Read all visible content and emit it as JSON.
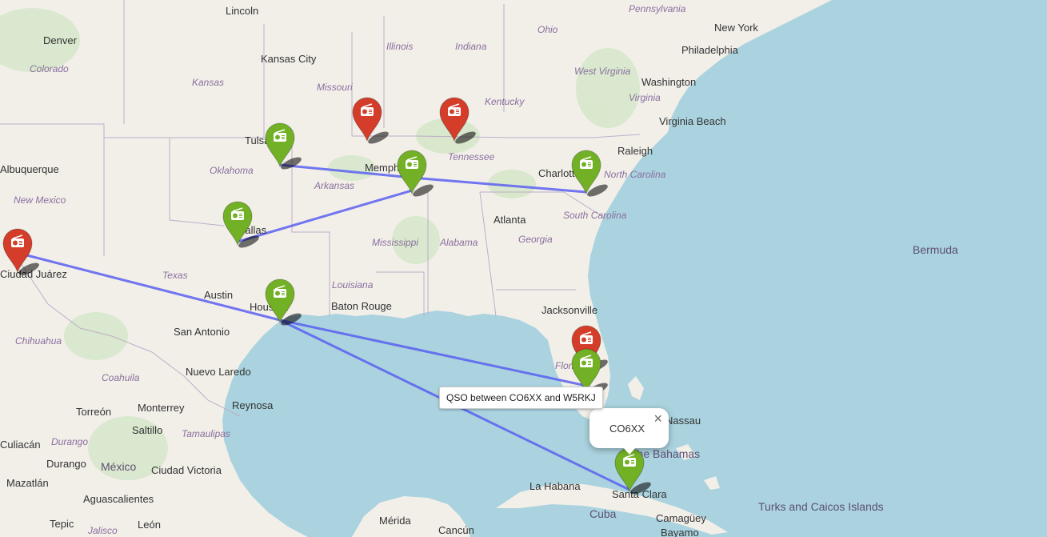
{
  "map": {
    "labels": {
      "cities": [
        "Lincoln",
        "Denver",
        "Kansas City",
        "Tulsa",
        "Memphis",
        "Charlotte",
        "Raleigh",
        "Virginia Beach",
        "Washington",
        "Philadelphia",
        "New York",
        "Atlanta",
        "Jacksonville",
        "Austin",
        "Houston",
        "San Antonio",
        "Baton Rouge",
        "Nuevo Laredo",
        "Reynosa",
        "Monterrey",
        "Torreón",
        "Saltillo",
        "Durango",
        "Ciudad Victoria",
        "Aguascalientes",
        "León",
        "Mazatlán",
        "Tepic",
        "Mérida",
        "Cancún",
        "La Habana",
        "Santa Clara",
        "Camagüey",
        "Bayamo",
        "Albuquerque",
        "Ciudad Juárez",
        "Dallas",
        "Nassau",
        "Culiacán"
      ],
      "states": [
        "Colorado",
        "Kansas",
        "Missouri",
        "Illinois",
        "Indiana",
        "Ohio",
        "Pennsylvania",
        "West Virginia",
        "Virginia",
        "Kentucky",
        "Tennessee",
        "North Carolina",
        "South Carolina",
        "Georgia",
        "Alabama",
        "Mississippi",
        "Arkansas",
        "Oklahoma",
        "Texas",
        "New Mexico",
        "Louisiana",
        "Florida",
        "Chihuahua",
        "Coahuila",
        "Tamaulipas",
        "Durango",
        "Jalisco"
      ],
      "countries": [
        "México",
        "Cuba",
        "The Bahamas",
        "Bermuda",
        "Turks and Caicos Islands"
      ]
    },
    "markers": [
      {
        "id": "missouri-station",
        "status": "red"
      },
      {
        "id": "tennessee-station",
        "status": "red"
      },
      {
        "id": "juarez-station",
        "status": "red"
      },
      {
        "id": "florida-station-red",
        "status": "red"
      },
      {
        "id": "tulsa-station",
        "status": "green"
      },
      {
        "id": "memphis-station",
        "status": "green"
      },
      {
        "id": "charlotte-station",
        "status": "green"
      },
      {
        "id": "dallas-station",
        "status": "green"
      },
      {
        "id": "houston-station",
        "status": "green"
      },
      {
        "id": "florida-station-green",
        "status": "green"
      },
      {
        "id": "santa-clara-station",
        "status": "green"
      }
    ],
    "marker_icon": "radio-icon",
    "colors": {
      "red": "#d33d29",
      "green": "#72b026",
      "line": "#5a5ff0",
      "water": "#aad3df",
      "land": "#f2efe9"
    }
  },
  "popup": {
    "title": "CO6XX",
    "close": "×"
  },
  "tooltip": {
    "text": "QSO between CO6XX and W5RKJ"
  }
}
